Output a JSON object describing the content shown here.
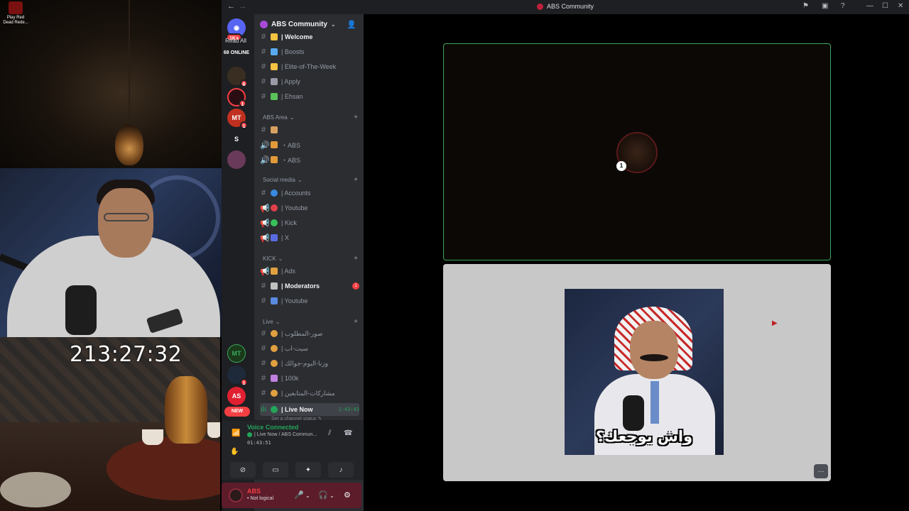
{
  "desktop": {
    "shortcut_label": "Play Red Dead Rede..."
  },
  "stream": {
    "timer": "213:27:32"
  },
  "titlebar": {
    "title": "ABS Community"
  },
  "rail": {
    "home_badge": "1K+",
    "read_all": "Read All",
    "online": "68 ONLINE",
    "servers": [
      {
        "label": "",
        "badge": "6"
      },
      {
        "label": "",
        "badge": "1"
      },
      {
        "label": "MT",
        "badge": "1"
      },
      {
        "label": "S",
        "badge": ""
      },
      {
        "label": "",
        "badge": ""
      },
      {
        "label": "MT",
        "badge": ""
      },
      {
        "label": "",
        "badge": "1"
      },
      {
        "label": "AS",
        "badge": ""
      }
    ],
    "new_label": "NEW"
  },
  "sidebar": {
    "server_name": "ABS Community",
    "channels_top": [
      {
        "name": "| Welcome",
        "emoji_color": "#f5c242",
        "bold": true
      },
      {
        "name": "| Boosts",
        "emoji_color": "#5aa8f0"
      },
      {
        "name": "| Elite-of-The-Week",
        "emoji_color": "#f5c242"
      },
      {
        "name": "| Apply",
        "emoji_color": "#9a9aa8"
      },
      {
        "name": "| Ehsan",
        "emoji_color": "#5ac05a"
      }
    ],
    "categories": [
      {
        "name": "ABS Area"
      },
      {
        "name": "Social media"
      },
      {
        "name": "KICK"
      },
      {
        "name": "Live"
      }
    ],
    "abs_area": [
      {
        "name": "",
        "emoji_color": "#d8a060",
        "type": "text"
      },
      {
        "name": "・ABS",
        "emoji_color": "#e09a3a",
        "type": "voice"
      },
      {
        "name": "・ABS",
        "emoji_color": "#e09a3a",
        "type": "voice"
      }
    ],
    "social": [
      {
        "name": "| Accounts",
        "emoji_color": "#3a8ae0",
        "type": "text"
      },
      {
        "name": "| Youtube",
        "emoji_color": "#e0404a",
        "type": "announce"
      },
      {
        "name": "| Kick",
        "emoji_color": "#3ac05a",
        "type": "announce"
      },
      {
        "name": "| X",
        "emoji_color": "#5a6ae0",
        "type": "announce"
      }
    ],
    "kick": [
      {
        "name": "| Ads",
        "emoji_color": "#e0a040",
        "type": "announce"
      },
      {
        "name": "| Moderators",
        "emoji_color": "#c0c0c0",
        "type": "text",
        "bold": true,
        "mention": "1"
      },
      {
        "name": "| Youtube",
        "emoji_color": "#5a8ae0",
        "type": "text"
      }
    ],
    "live": [
      {
        "name": "| صور-المطلوب",
        "emoji_color": "#e0a040",
        "type": "text"
      },
      {
        "name": "| سيت-اب",
        "emoji_color": "#e0a040",
        "type": "text"
      },
      {
        "name": "| وزنا-اليوم-جوالك",
        "emoji_color": "#e0a040",
        "type": "text"
      },
      {
        "name": "| 100k",
        "emoji_color": "#c080e0",
        "type": "text"
      },
      {
        "name": "| مشاركات-المتابعين",
        "emoji_color": "#e0a040",
        "type": "text"
      }
    ],
    "live_now": {
      "name": "| Live Now",
      "time": "1:43:43",
      "status": "Set a channel status"
    }
  },
  "voice": {
    "connected": "Voice Connected",
    "channel": "| Live Now / ABS Commun...",
    "timer": "01:43:51"
  },
  "user": {
    "name": "ABS",
    "status": "• Not logical"
  },
  "main": {
    "tile_badge": "1",
    "meme_caption": "واش يوجعك؟",
    "more_label": "···"
  }
}
